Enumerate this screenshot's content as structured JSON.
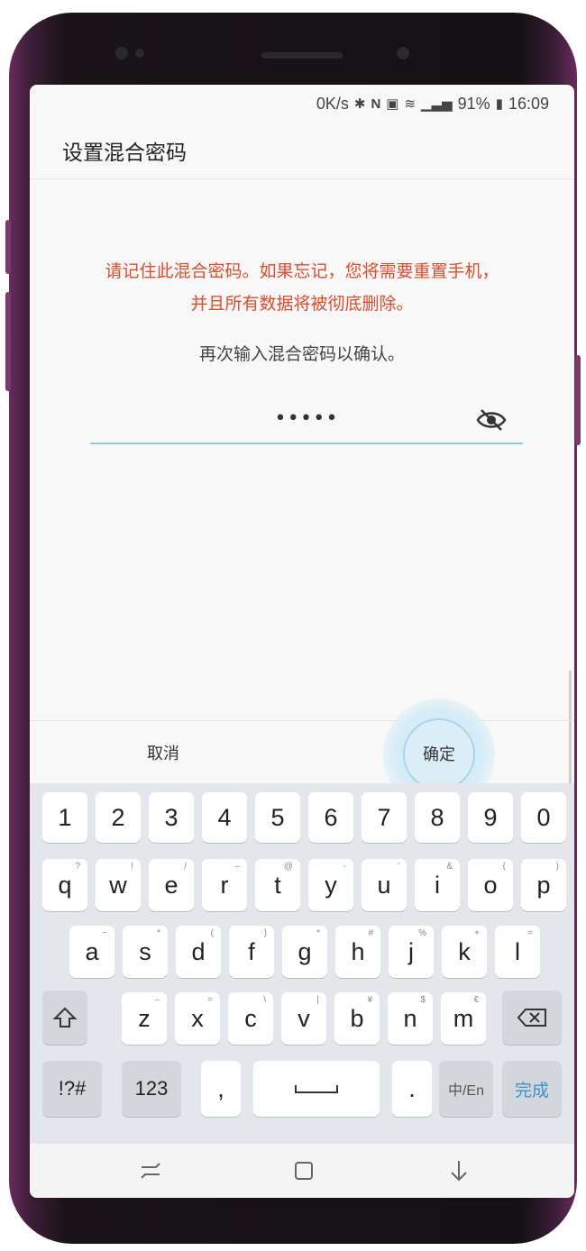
{
  "status_bar": {
    "speed": "0K/s",
    "battery": "91%",
    "time": "16:09",
    "icons": [
      "bluetooth-icon",
      "nfc-icon",
      "vibrate-icon",
      "wifi-icon",
      "signal-icon",
      "battery-icon"
    ]
  },
  "dialog": {
    "title": "设置混合密码",
    "warning_line1": "请记住此混合密码。如果忘记，您将需要重置手机，",
    "warning_line2": "并且所有数据将被彻底删除。",
    "confirm_prompt": "再次输入混合密码以确认。",
    "password_masked": "•••••",
    "cancel_label": "取消",
    "ok_label": "确定"
  },
  "keyboard": {
    "row_numbers": [
      "1",
      "2",
      "3",
      "4",
      "5",
      "6",
      "7",
      "8",
      "9",
      "0"
    ],
    "row_q": [
      {
        "k": "q",
        "h": "?"
      },
      {
        "k": "w",
        "h": "!"
      },
      {
        "k": "e",
        "h": "/"
      },
      {
        "k": "r",
        "h": "–"
      },
      {
        "k": "t",
        "h": "@"
      },
      {
        "k": "y",
        "h": "-"
      },
      {
        "k": "u",
        "h": "'"
      },
      {
        "k": "i",
        "h": "&"
      },
      {
        "k": "o",
        "h": "("
      },
      {
        "k": "p",
        "h": ")"
      }
    ],
    "row_a": [
      {
        "k": "a",
        "h": "~"
      },
      {
        "k": "s",
        "h": "*"
      },
      {
        "k": "d",
        "h": "("
      },
      {
        "k": "f",
        "h": ")"
      },
      {
        "k": "g",
        "h": "*"
      },
      {
        "k": "h",
        "h": "#"
      },
      {
        "k": "j",
        "h": "%"
      },
      {
        "k": "k",
        "h": "+"
      },
      {
        "k": "l",
        "h": "="
      }
    ],
    "row_z": [
      {
        "k": "z",
        "h": "–"
      },
      {
        "k": "x",
        "h": "="
      },
      {
        "k": "c",
        "h": "\\"
      },
      {
        "k": "v",
        "h": "|"
      },
      {
        "k": "b",
        "h": "¥"
      },
      {
        "k": "n",
        "h": "$"
      },
      {
        "k": "m",
        "h": "€"
      }
    ],
    "symbols_label": "!?#",
    "numbers_label": "123",
    "comma_label": ",",
    "period_label": ".",
    "lang_label": "中/En",
    "done_label": "完成"
  },
  "colors": {
    "warning": "#e04b2b",
    "accent": "#3a8fd0",
    "underline": "#8fcfd0"
  },
  "nav": {
    "icons": [
      "recents-icon",
      "home-icon",
      "back-icon"
    ]
  }
}
